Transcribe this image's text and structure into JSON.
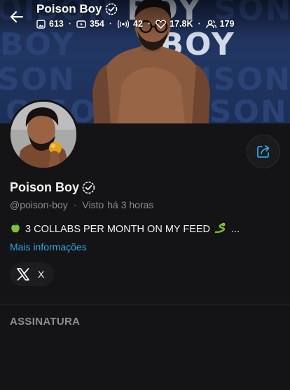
{
  "cover": {
    "text_rows": [
      "OISON BOY",
      "BOY  BOY",
      "SON  SON",
      "OISON BOYSON"
    ],
    "accent_color": "#213663"
  },
  "header": {
    "back_icon": "arrow-left-icon",
    "title": "Poison Boy",
    "stats": {
      "photos": "613",
      "videos": "354",
      "live": "42",
      "likes": "17.8K",
      "fans": "179"
    }
  },
  "profile": {
    "name": "Poison Boy",
    "handle": "@poison-boy",
    "separator": "·",
    "seen_label": "Visto",
    "seen_time": "há 3 horas",
    "bio": "3 COLLABS PER MONTH ON MY FEED",
    "bio_ellipsis": "...",
    "more_info": "Mais informações",
    "social_label": "X",
    "link_color": "#2fa6e6"
  },
  "sections": {
    "subscription_title": "ASSINATURA"
  }
}
